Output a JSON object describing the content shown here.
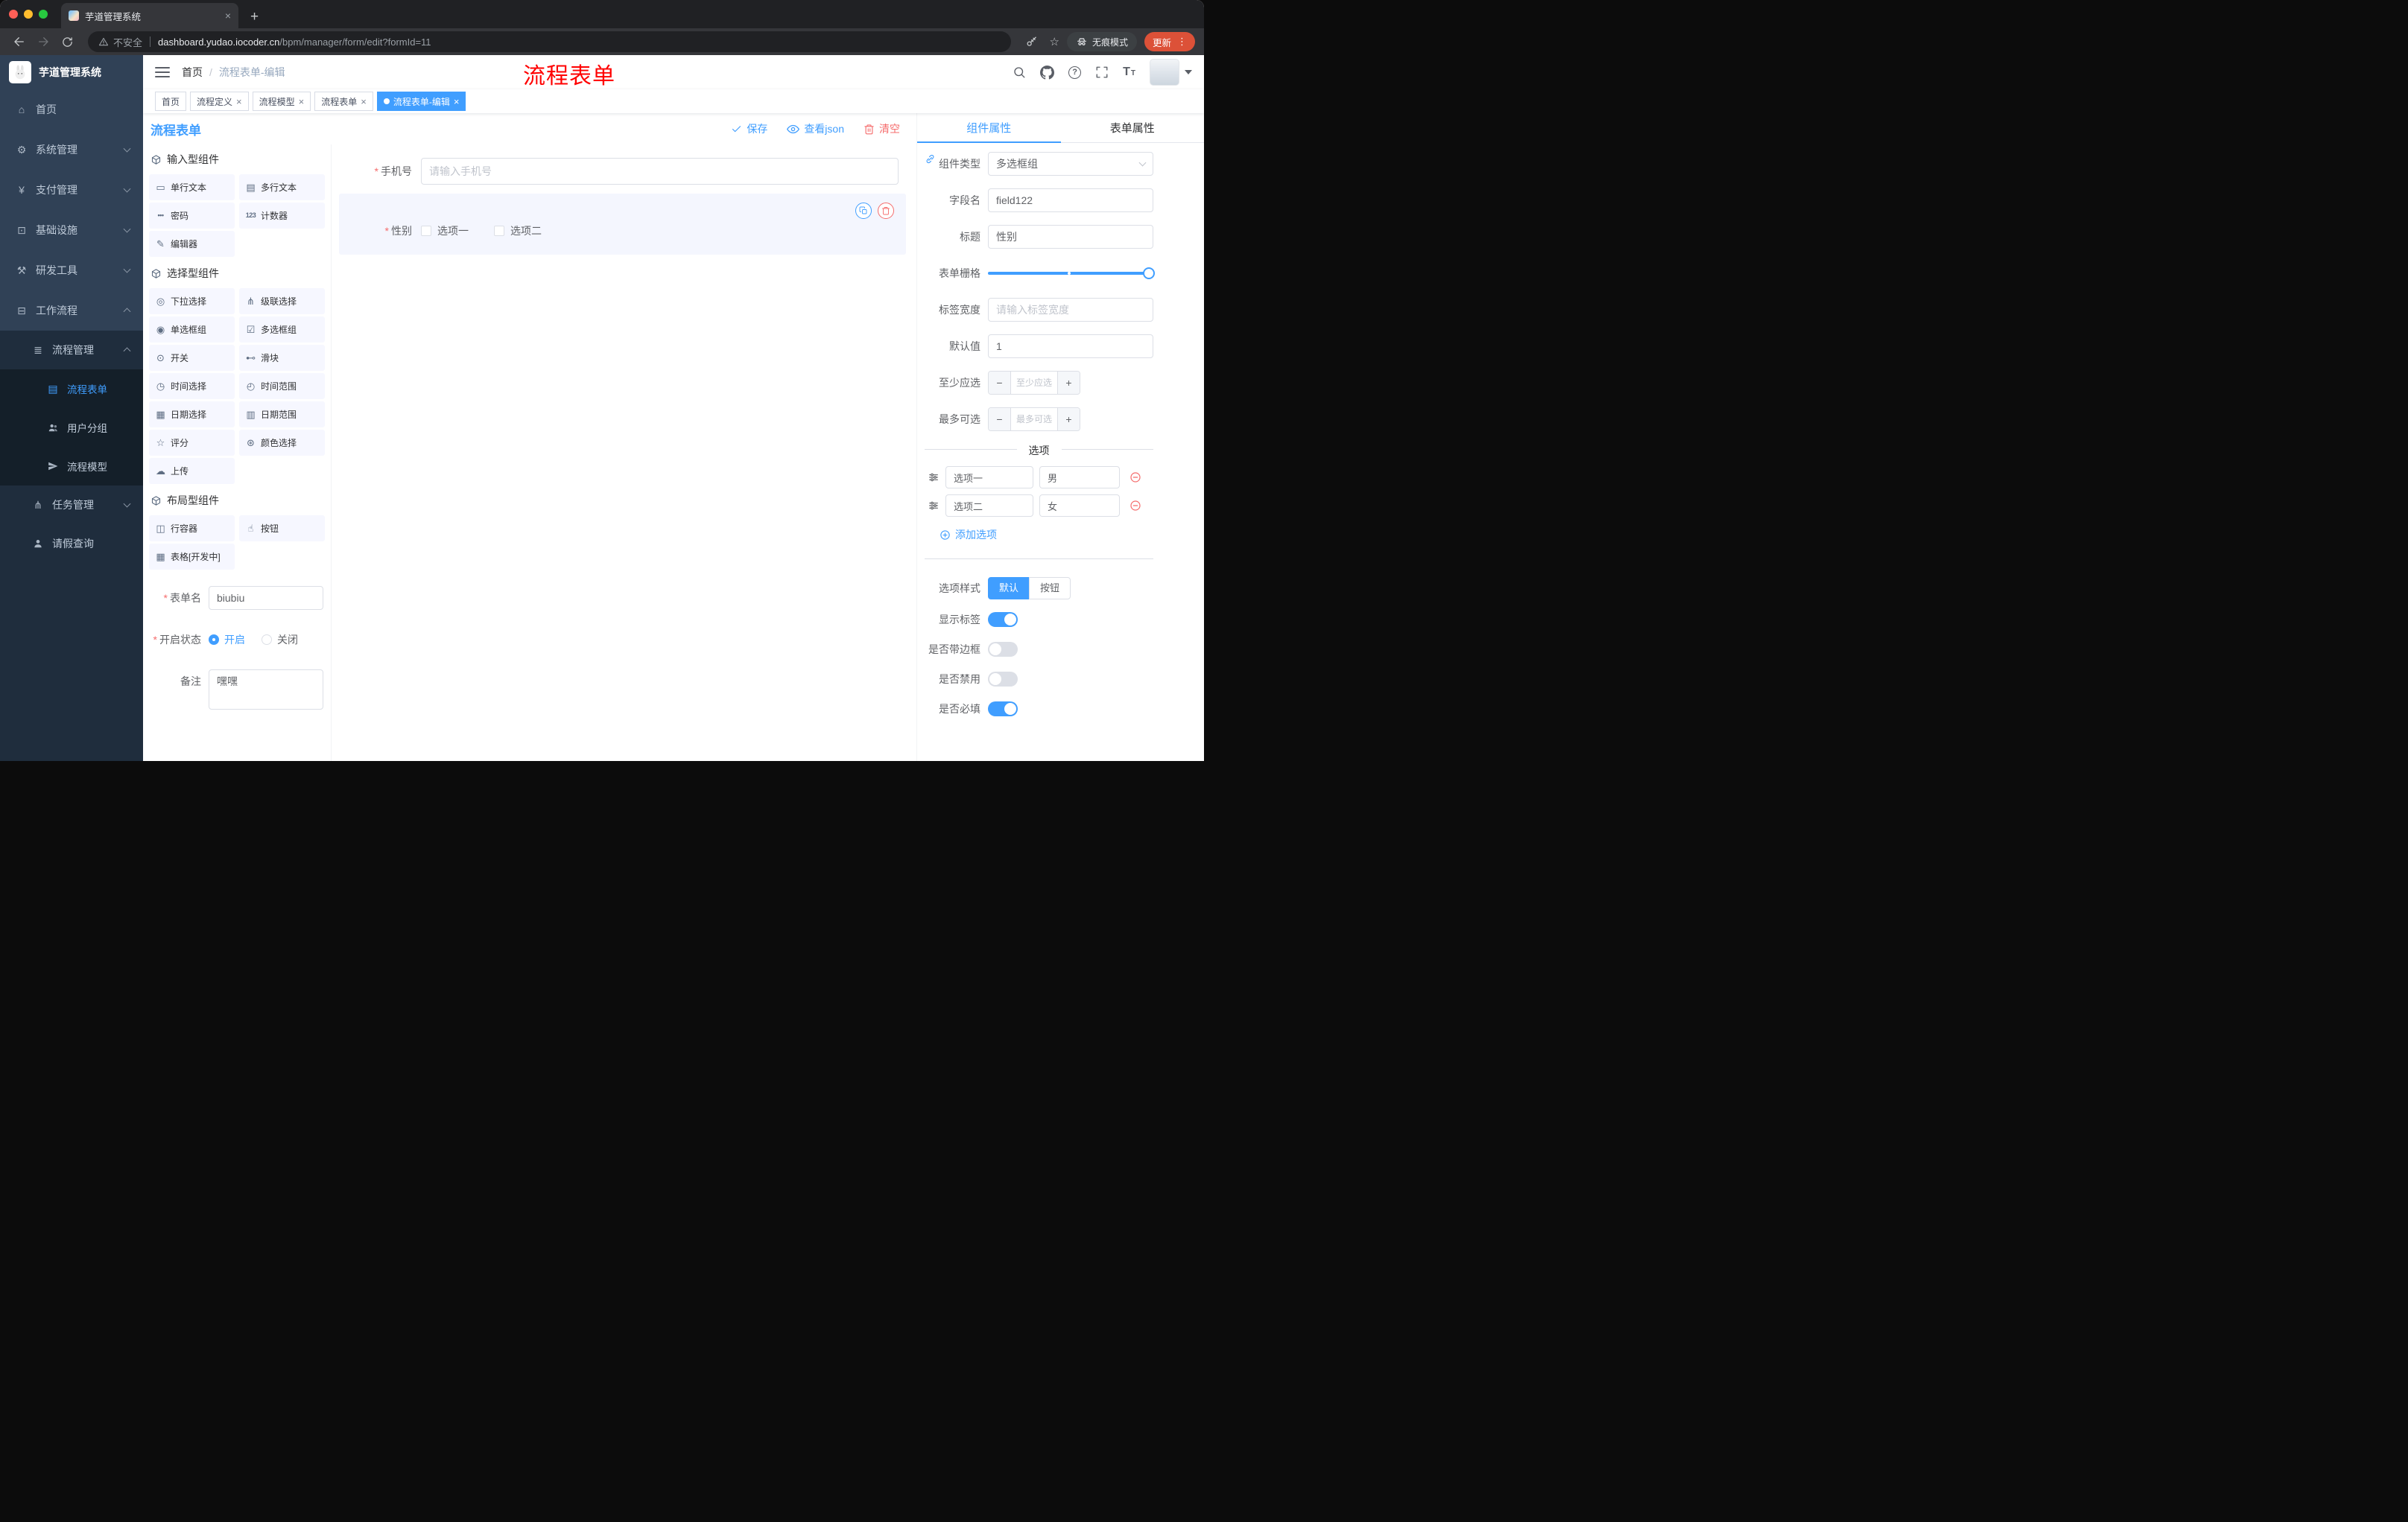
{
  "browser": {
    "tab_title": "芋道管理系统",
    "security": "不安全",
    "url_host": "dashboard.yudao.iocoder.cn",
    "url_path": "/bpm/manager/form/edit?formId=11",
    "incognito": "无痕模式",
    "update": "更新"
  },
  "sidebar": {
    "title": "芋道管理系统",
    "items": [
      {
        "label": "首页",
        "level": 1
      },
      {
        "label": "系统管理",
        "level": 1
      },
      {
        "label": "支付管理",
        "level": 1
      },
      {
        "label": "基础设施",
        "level": 1
      },
      {
        "label": "研发工具",
        "level": 1
      },
      {
        "label": "工作流程",
        "level": 1,
        "expanded": true
      },
      {
        "label": "流程管理",
        "level": 2,
        "expanded": true
      },
      {
        "label": "流程表单",
        "level": 3,
        "active": true
      },
      {
        "label": "用户分组",
        "level": 3
      },
      {
        "label": "流程模型",
        "level": 3
      },
      {
        "label": "任务管理",
        "level": 2
      },
      {
        "label": "请假查询",
        "level": 2
      }
    ]
  },
  "header": {
    "breadcrumb_home": "首页",
    "breadcrumb_sep": "/",
    "breadcrumb_current": "流程表单-编辑",
    "watermark": "流程表单"
  },
  "tags": [
    {
      "label": "首页",
      "closable": false,
      "active": false
    },
    {
      "label": "流程定义",
      "closable": true,
      "active": false
    },
    {
      "label": "流程模型",
      "closable": true,
      "active": false
    },
    {
      "label": "流程表单",
      "closable": true,
      "active": false
    },
    {
      "label": "流程表单-编辑",
      "closable": true,
      "active": true
    }
  ],
  "toolbar": {
    "title": "流程表单",
    "save": "保存",
    "view_json": "查看json",
    "clear": "清空"
  },
  "components": {
    "section_input": "输入型组件",
    "section_select": "选择型组件",
    "section_layout": "布局型组件",
    "input_items": [
      "单行文本",
      "多行文本",
      "密码",
      "计数器",
      "编辑器"
    ],
    "select_items": [
      "下拉选择",
      "级联选择",
      "单选框组",
      "多选框组",
      "开关",
      "滑块",
      "时间选择",
      "时间范围",
      "日期选择",
      "日期范围",
      "评分",
      "颜色选择",
      "上传"
    ],
    "layout_items": [
      "行容器",
      "按钮",
      "表格[开发中]"
    ],
    "form_name_label": "表单名",
    "form_name_value": "biubiu",
    "status_label": "开启状态",
    "status_on": "开启",
    "status_off": "关闭",
    "remark_label": "备注",
    "remark_value": "嘿嘿"
  },
  "canvas": {
    "phone_label": "手机号",
    "phone_placeholder": "请输入手机号",
    "gender_label": "性别",
    "gender_opt1": "选项一",
    "gender_opt2": "选项二"
  },
  "props": {
    "tab_component": "组件属性",
    "tab_form": "表单属性",
    "type_label": "组件类型",
    "type_value": "多选框组",
    "field_label": "字段名",
    "field_value": "field122",
    "title_label": "标题",
    "title_value": "性别",
    "grid_label": "表单栅格",
    "width_label": "标签宽度",
    "width_placeholder": "请输入标签宽度",
    "default_label": "默认值",
    "default_value": "1",
    "min_label": "至少应选",
    "min_placeholder": "至少应选",
    "max_label": "最多可选",
    "max_placeholder": "最多可选",
    "options_title": "选项",
    "options": [
      {
        "label": "选项一",
        "value": "男"
      },
      {
        "label": "选项二",
        "value": "女"
      }
    ],
    "add_option": "添加选项",
    "style_label": "选项样式",
    "style_default": "默认",
    "style_button": "按钮",
    "toggle_show_label": "显示标签",
    "toggle_border": "是否带边框",
    "toggle_disabled": "是否禁用",
    "toggle_required": "是否必填",
    "toggle_states": {
      "show_label": true,
      "border": false,
      "disabled": false,
      "required": true
    }
  },
  "misc": {
    "required": "*"
  },
  "icons": {
    "close": "×",
    "plus": "+",
    "dots": "⋮",
    "star": "☆",
    "question": "?",
    "minus": "−",
    "font_large": "T",
    "font_small": "T",
    "home": "⌂",
    "gear": "⚙",
    "yen": "¥",
    "infra": "⊡",
    "tools": "⚒",
    "workflow": "⊟",
    "process": "≣",
    "form_doc": "▤",
    "branch": "⋔",
    "single_text": "▭",
    "multi_text": "▤",
    "password": "•••",
    "counter": "123",
    "editor": "✎",
    "select": "◎",
    "cascade": "⋔",
    "radio_group": "◉",
    "checkbox_group": "☑",
    "switch": "⊙",
    "slider": "⊷",
    "time": "◷",
    "time_range": "◴",
    "date": "▦",
    "date_range": "▥",
    "rate": "☆",
    "color": "⊛",
    "upload": "☁",
    "row": "◫",
    "button": "☝",
    "table": "▦"
  },
  "colors": {
    "primary": "#409EFF",
    "danger": "#F56C6C",
    "watermark_red": "#FF0000",
    "sidebar_bg": "#304156",
    "submenu_bg": "#1F2D3D",
    "submenu_deep_bg": "#141F29",
    "update_button": "#DC5138",
    "chip_bg": "#F6F7FF",
    "selected_item_bg": "#F4F6FE"
  }
}
